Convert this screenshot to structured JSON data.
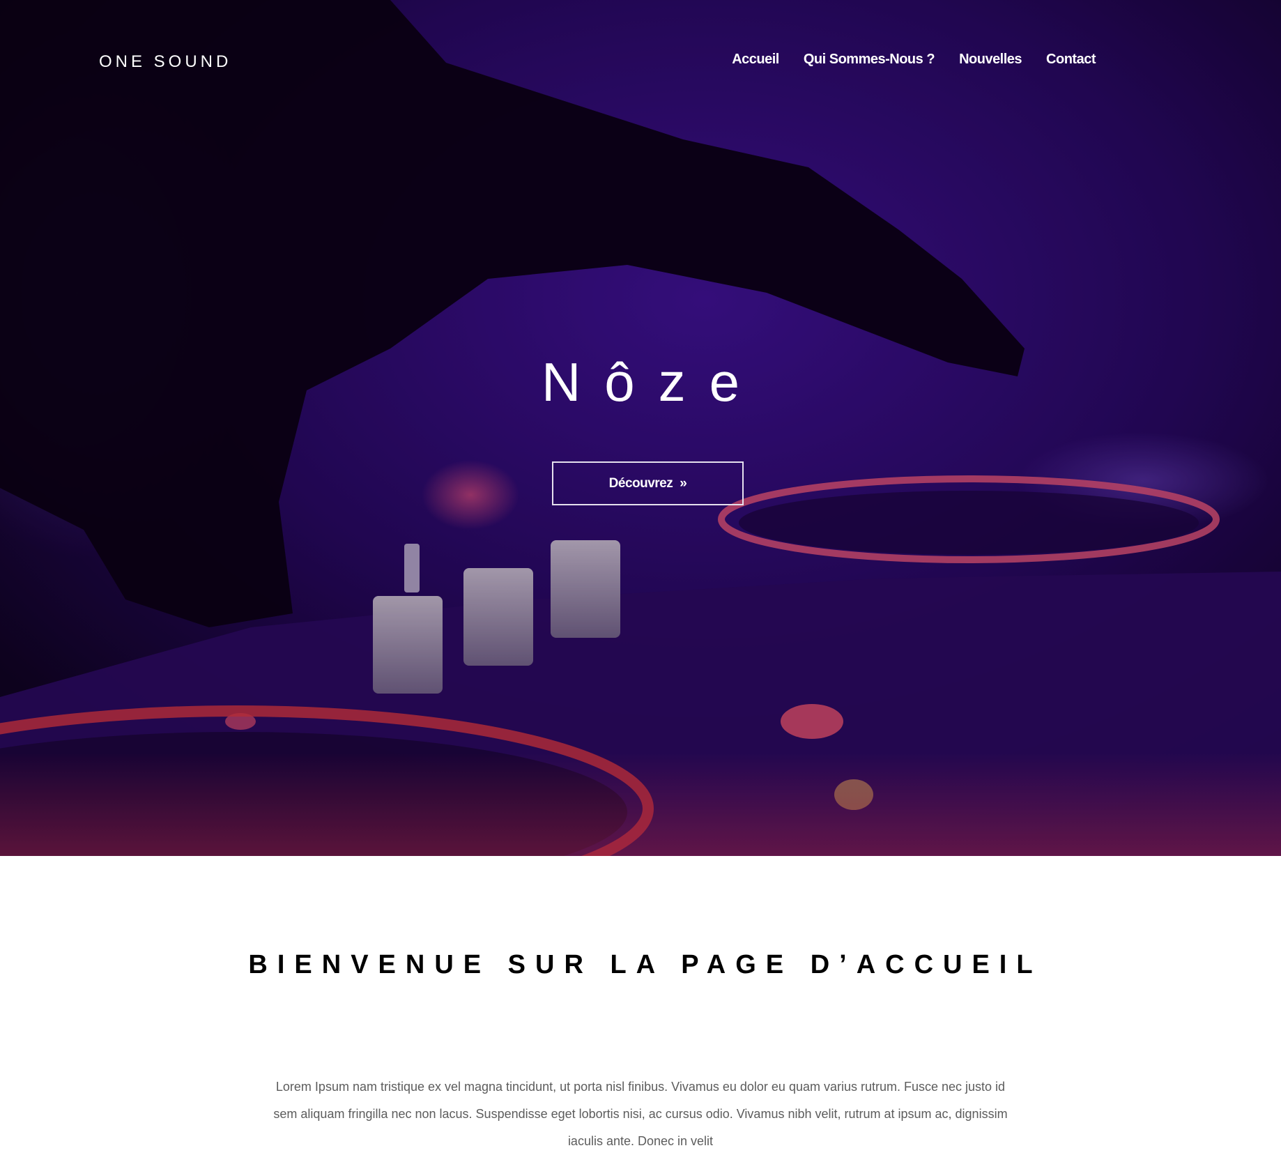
{
  "header": {
    "logo": "ONE SOUND",
    "nav": [
      {
        "label": "Accueil"
      },
      {
        "label": "Qui Sommes-Nous ?"
      },
      {
        "label": "Nouvelles"
      },
      {
        "label": "Contact"
      }
    ]
  },
  "hero": {
    "title": "Nôze",
    "button_label": "Découvrez",
    "button_icon": "double-chevron-right-icon",
    "background": "dj-turntable-mixer-photo",
    "colors": {
      "deep": "#0b0216",
      "violet": "#3b0f8c",
      "magenta": "#b0208f",
      "red": "#d8363f"
    }
  },
  "main": {
    "heading": "BIENVENUE SUR LA PAGE D’ACCUEIL",
    "paragraph": "Lorem Ipsum nam tristique ex vel magna tincidunt, ut porta nisl finibus. Vivamus eu dolor eu quam varius rutrum. Fusce nec justo id sem aliquam fringilla nec non lacus. Suspendisse eget lobortis nisi, ac cursus odio. Vivamus nibh velit, rutrum at ipsum ac, dignissim iaculis ante. Donec in velit"
  }
}
